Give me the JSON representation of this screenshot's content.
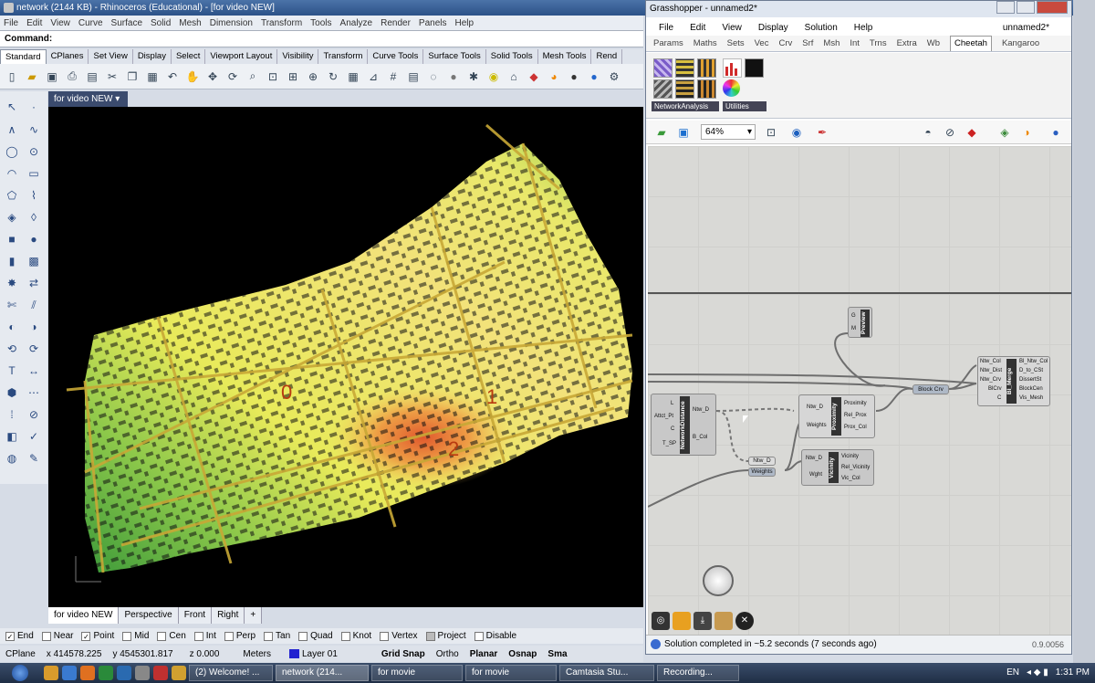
{
  "rhino": {
    "title": "network (2144 KB) - Rhinoceros (Educational) - [for video NEW]",
    "menu": [
      "File",
      "Edit",
      "View",
      "Curve",
      "Surface",
      "Solid",
      "Mesh",
      "Dimension",
      "Transform",
      "Tools",
      "Analyze",
      "Render",
      "Panels",
      "Help"
    ],
    "command_label": "Command:",
    "tool_tabs": [
      "Standard",
      "CPlanes",
      "Set View",
      "Display",
      "Select",
      "Viewport Layout",
      "Visibility",
      "Transform",
      "Curve Tools",
      "Surface Tools",
      "Solid Tools",
      "Mesh Tools",
      "Rend"
    ],
    "viewport_tab": "for video NEW",
    "viewport_labels": [
      "0",
      "1",
      "2"
    ],
    "bottom_tabs": [
      "for video NEW",
      "Perspective",
      "Front",
      "Right",
      "+"
    ],
    "osnap": [
      {
        "label": "End",
        "checked": true
      },
      {
        "label": "Near",
        "checked": false
      },
      {
        "label": "Point",
        "checked": true
      },
      {
        "label": "Mid",
        "checked": false
      },
      {
        "label": "Cen",
        "checked": false
      },
      {
        "label": "Int",
        "checked": false
      },
      {
        "label": "Perp",
        "checked": false
      },
      {
        "label": "Tan",
        "checked": false
      },
      {
        "label": "Quad",
        "checked": false
      },
      {
        "label": "Knot",
        "checked": false
      },
      {
        "label": "Vertex",
        "checked": false
      },
      {
        "label": "Project",
        "checked": false
      },
      {
        "label": "Disable",
        "checked": false
      }
    ],
    "status": {
      "cplane": "CPlane",
      "x": "x 414578.225",
      "y": "y 4545301.817",
      "z": "z 0.000",
      "units": "Meters",
      "layer": "Layer 01",
      "grid_snap": "Grid Snap",
      "ortho": "Ortho",
      "planar": "Planar",
      "osnap": "Osnap",
      "smart": "Sma"
    }
  },
  "grasshopper": {
    "title": "Grasshopper - unnamed2*",
    "menu": [
      "File",
      "Edit",
      "View",
      "Display",
      "Solution",
      "Help"
    ],
    "document": "unnamed2*",
    "tabs": [
      "Params",
      "Maths",
      "Sets",
      "Vec",
      "Crv",
      "Srf",
      "Msh",
      "Int",
      "Trns",
      "Extra",
      "Wb",
      "Cheetah",
      "Kangaroo"
    ],
    "active_tab": "Cheetah",
    "ribbon_groups": [
      "NetworkAnalysis",
      "Utilities"
    ],
    "zoom": "64%",
    "components": {
      "preview": {
        "name": "Preview",
        "inputs": [
          "G",
          "M"
        ]
      },
      "network": {
        "name": "NetworkDistance",
        "inputs": [
          "L",
          "Attct_Pt",
          "C",
          "T_SP"
        ],
        "outputs": [
          "Ntw_D",
          "B_Col"
        ]
      },
      "proximity": {
        "name": "Proximity",
        "inputs": [
          "Ntw_D",
          "Weights"
        ],
        "outputs": [
          "Proximity",
          "Rel_Prox",
          "Prox_Col"
        ]
      },
      "vicinity": {
        "name": "Vicinity",
        "inputs": [
          "Ntw_D",
          "Wght"
        ],
        "outputs": [
          "Vicinity",
          "Rel_Vicinity",
          "Vic_Col"
        ]
      },
      "block": {
        "name": "Block Crv"
      },
      "ntw_relay": {
        "name": "Ntw_D"
      },
      "weights_relay": {
        "name": "Weights"
      },
      "output": {
        "name": "Bl_Merge",
        "inputs": [
          "Ntw_Col",
          "Ntw_Dist",
          "Ntw_Crv",
          "BlCrv",
          "C"
        ],
        "outputs": [
          "Bl_Ntw_Col",
          "D_to_CSt",
          "DissertSt",
          "BlockCen",
          "Vis_Mesh"
        ]
      }
    },
    "status": "Solution completed in ~5.2 seconds (7 seconds ago)",
    "version": "0.9.0056"
  },
  "taskbar": {
    "items": [
      "(2) Welcome! ...",
      "network (214...",
      "for movie",
      "for movie",
      "Camtasia Stu...",
      "Recording..."
    ],
    "lang": "EN",
    "time": "1:31 PM"
  }
}
